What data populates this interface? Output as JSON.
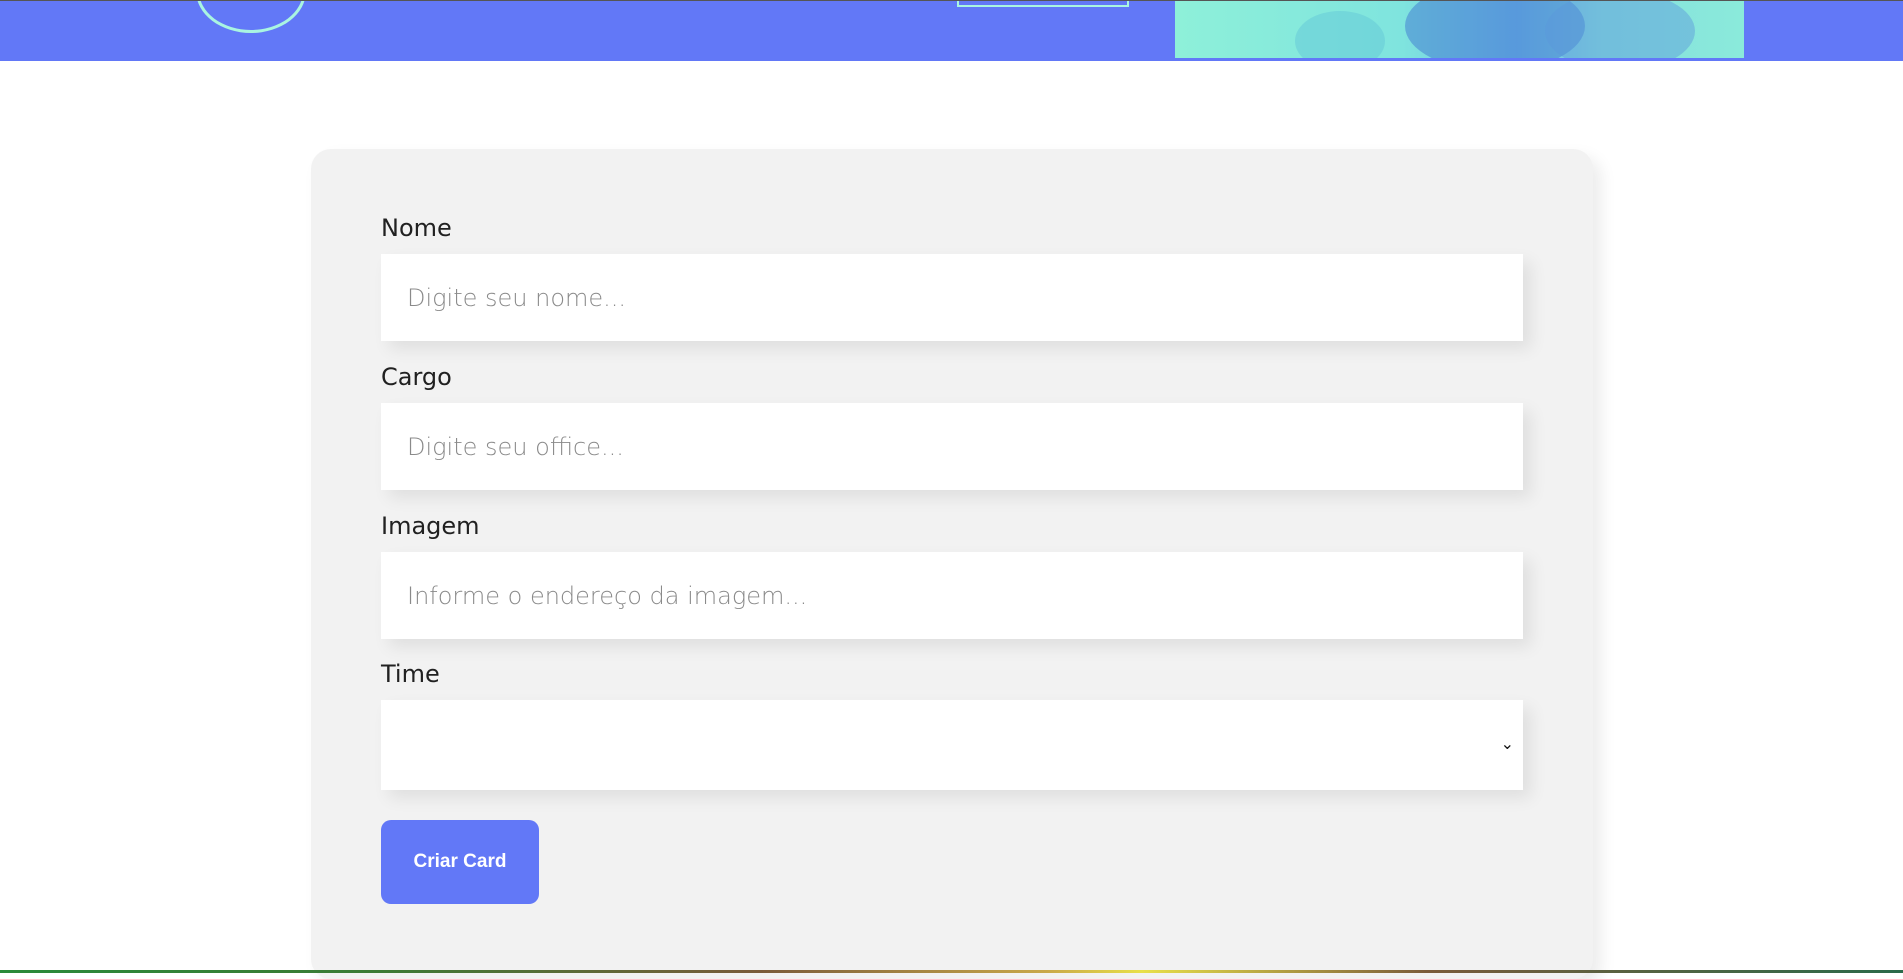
{
  "form": {
    "fields": [
      {
        "label": "Nome",
        "placeholder": "Digite seu nome...",
        "value": ""
      },
      {
        "label": "Cargo",
        "placeholder": "Digite seu office...",
        "value": ""
      },
      {
        "label": "Imagem",
        "placeholder": "Informe o endereço da imagem...",
        "value": ""
      }
    ],
    "select": {
      "label": "Time",
      "selected": ""
    },
    "submit_label": "Criar Card"
  },
  "colors": {
    "accent": "#6278f7",
    "banner_line": "#a9f5e1",
    "card_background": "#f2f2f2"
  },
  "icons": {
    "select_chevron": "chevron-down-icon"
  }
}
